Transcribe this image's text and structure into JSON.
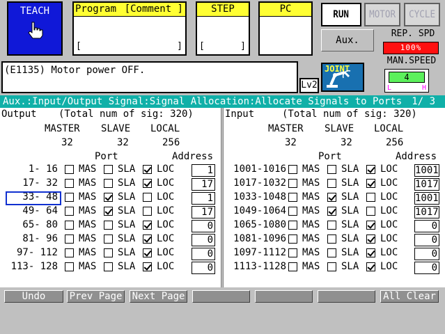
{
  "header": {
    "teach_label": "TEACH",
    "program_label": "Program",
    "comment_label": "[Comment ]",
    "program_bracket_left": "[",
    "program_bracket_right": "]",
    "step_label": "STEP",
    "step_bracket_left": "[",
    "step_bracket_right": "]",
    "pc_label": "PC",
    "run_label": "RUN",
    "motor_label": "MOTOR",
    "cycle_label": "CYCLE",
    "aux_label": "Aux.",
    "rep_spd_label": "REP. SPD",
    "rep_spd_value": "100%",
    "rep_spd_fraction": 1.0,
    "man_speed_label": "MAN.SPEED",
    "man_speed_value": "4",
    "man_speed_low": "L",
    "man_speed_high": "H",
    "joint_label": "JOINT",
    "message": "(E1135) Motor power OFF.",
    "level": "Lv2"
  },
  "breadcrumb": {
    "path": "Aux.:Input/Output Signal:Signal Allocation:Allocate Signals to Ports",
    "page": "1/  3"
  },
  "output": {
    "title": "Output",
    "total": "(Total num of sig: 320)",
    "master_label": "MASTER",
    "slave_label": "SLAVE",
    "local_label": "LOCAL",
    "master_value": "32",
    "slave_value": "32",
    "local_value": "256",
    "port_label": "Port",
    "address_label": "Address",
    "rows": [
      {
        "range": "1-  16",
        "mas": false,
        "sla": false,
        "loc": true,
        "address": "1"
      },
      {
        "range": "17-  32",
        "mas": false,
        "sla": false,
        "loc": true,
        "address": "17"
      },
      {
        "range": "33-  48",
        "mas": false,
        "sla": true,
        "loc": false,
        "address": "1"
      },
      {
        "range": "49-  64",
        "mas": false,
        "sla": true,
        "loc": false,
        "address": "17"
      },
      {
        "range": "65-  80",
        "mas": false,
        "sla": false,
        "loc": true,
        "address": "0"
      },
      {
        "range": "81-  96",
        "mas": false,
        "sla": false,
        "loc": true,
        "address": "0"
      },
      {
        "range": "97- 112",
        "mas": false,
        "sla": false,
        "loc": true,
        "address": "0"
      },
      {
        "range": "113- 128",
        "mas": false,
        "sla": false,
        "loc": true,
        "address": "0"
      }
    ]
  },
  "input": {
    "title": "Input",
    "total": "(Total num of sig: 320)",
    "master_label": "MASTER",
    "slave_label": "SLAVE",
    "local_label": "LOCAL",
    "master_value": "32",
    "slave_value": "32",
    "local_value": "256",
    "port_label": "Port",
    "address_label": "Address",
    "rows": [
      {
        "range": "1001-1016",
        "mas": false,
        "sla": false,
        "loc": true,
        "address": "1001"
      },
      {
        "range": "1017-1032",
        "mas": false,
        "sla": false,
        "loc": true,
        "address": "1017"
      },
      {
        "range": "1033-1048",
        "mas": false,
        "sla": true,
        "loc": false,
        "address": "1001"
      },
      {
        "range": "1049-1064",
        "mas": false,
        "sla": true,
        "loc": false,
        "address": "1017"
      },
      {
        "range": "1065-1080",
        "mas": false,
        "sla": false,
        "loc": true,
        "address": "0"
      },
      {
        "range": "1081-1096",
        "mas": false,
        "sla": false,
        "loc": true,
        "address": "0"
      },
      {
        "range": "1097-1112",
        "mas": false,
        "sla": false,
        "loc": true,
        "address": "0"
      },
      {
        "range": "1113-1128",
        "mas": false,
        "sla": false,
        "loc": true,
        "address": "0"
      }
    ]
  },
  "port_labels": {
    "mas": "MAS",
    "sla": "SLA",
    "loc": "LOC"
  },
  "footer": [
    "Undo",
    "Prev Page",
    "Next Page",
    "",
    "",
    "",
    "All Clear"
  ]
}
